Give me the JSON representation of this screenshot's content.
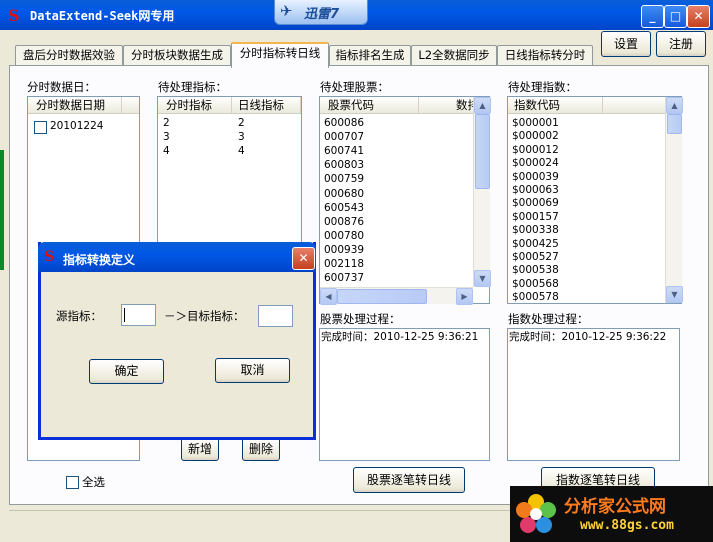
{
  "window": {
    "title": "DataExtend-Seek网专用",
    "taskbar_badge": "迅雷7",
    "controls": {
      "minimize": "_",
      "maximize": "□",
      "close": "✕"
    }
  },
  "header_buttons": {
    "settings": "设置",
    "register": "注册"
  },
  "tabs": [
    {
      "label": "盘后分时数据效验",
      "active": false
    },
    {
      "label": "分时板块数据生成",
      "active": false
    },
    {
      "label": "分时指标转日线",
      "active": true
    },
    {
      "label": "指标排名生成",
      "active": false
    },
    {
      "label": "L2全数据同步",
      "active": false
    },
    {
      "label": "日线指标转分时",
      "active": false
    }
  ],
  "date_panel": {
    "label": "分时数据日：",
    "column": "分时数据日期",
    "rows": [
      "20101224"
    ]
  },
  "indicator_panel": {
    "label": "待处理指标：",
    "columns": [
      "分时指标",
      "日线指标"
    ],
    "rows": [
      [
        "2",
        "2"
      ],
      [
        "3",
        "3"
      ],
      [
        "4",
        "4"
      ]
    ],
    "add_label": "新增",
    "delete_label": "删除"
  },
  "select_all_label": "全选",
  "stock_panel": {
    "label": "待处理股票：",
    "columns": [
      "股票代码",
      "数排"
    ],
    "rows": [
      "600086",
      "000707",
      "600741",
      "600803",
      "000759",
      "000680",
      "600543",
      "000876",
      "000780",
      "000939",
      "002118",
      "600737"
    ],
    "process_label": "股票处理过程：",
    "process_log": "完成时间：2010-12-25 9:36:21",
    "button": "股票逐笔转日线"
  },
  "index_panel": {
    "label": "待处理指数：",
    "column": "指数代码",
    "rows": [
      "$000001",
      "$000002",
      "$000012",
      "$000024",
      "$000039",
      "$000063",
      "$000069",
      "$000157",
      "$000338",
      "$000425",
      "$000527",
      "$000538",
      "$000568",
      "$000578"
    ],
    "process_label": "指数处理过程：",
    "process_log": "完成时间：2010-12-25 9:36:22",
    "button": "指数逐笔转日线"
  },
  "dialog": {
    "title": "指标转换定义",
    "source_label": "源指标：",
    "source_value": "",
    "arrow_label": "－＞目标指标：",
    "target_value": "",
    "ok_label": "确定",
    "cancel_label": "取消"
  },
  "watermark": {
    "name": "分析家公式网",
    "url": "www.88gs.com"
  }
}
